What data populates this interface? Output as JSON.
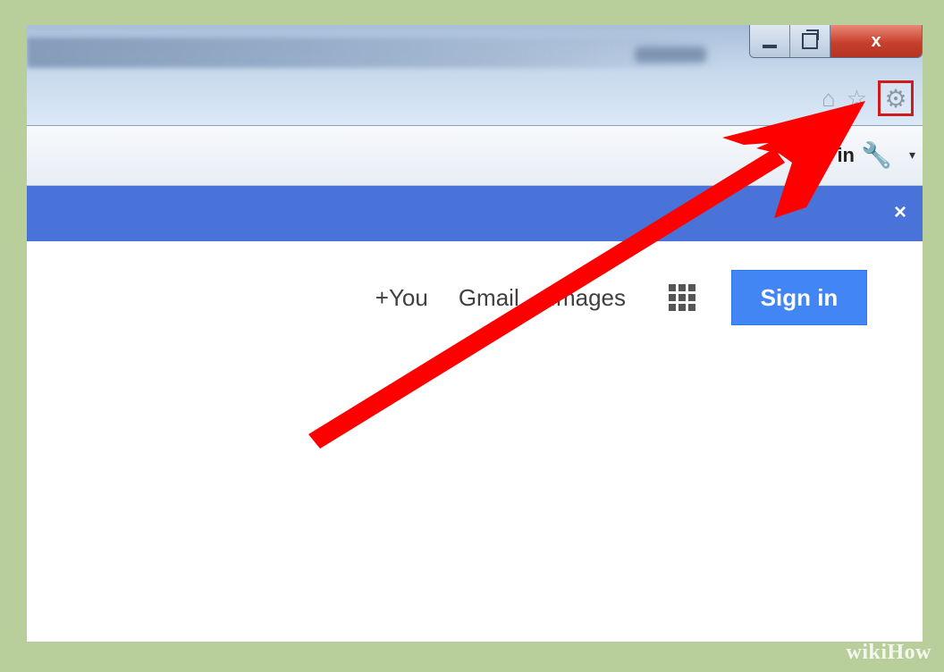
{
  "window": {
    "minimize_icon": "minimize-icon",
    "restore_icon": "restore-icon",
    "close_label": "x"
  },
  "toolbar": {
    "home_icon": "home-icon",
    "favorites_icon": "star-icon",
    "tools_icon": "gear-icon",
    "home_glyph": "⌂",
    "star_glyph": "☆",
    "gear_glyph": "⚙",
    "highlight_color": "#d01b1b"
  },
  "secondary_bar": {
    "signin_text": "Sign in",
    "wrench_glyph": "🔧",
    "dropdown_glyph": "▾"
  },
  "notification_bar": {
    "close_label": "×",
    "color": "#4a73d9"
  },
  "google_bar": {
    "links": [
      "+You",
      "Gmail",
      "Images"
    ],
    "signin_button": "Sign in",
    "signin_color": "#4285f4"
  },
  "annotation": {
    "arrow_color": "#ff0000",
    "points_to": "gear-icon"
  },
  "watermark": {
    "text": "wikiHow"
  }
}
